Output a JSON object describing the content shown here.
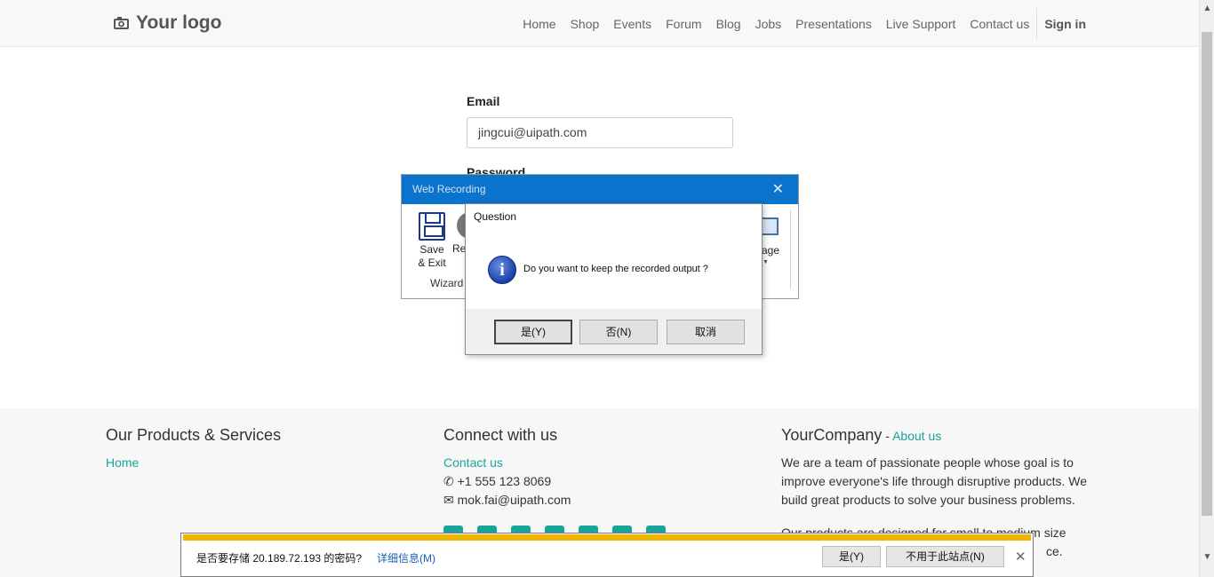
{
  "header": {
    "logo_text": "Your logo",
    "nav": [
      "Home",
      "Shop",
      "Events",
      "Forum",
      "Blog",
      "Jobs",
      "Presentations",
      "Live Support",
      "Contact us"
    ],
    "signin": "Sign in"
  },
  "form": {
    "email_label": "Email",
    "email_value": "jingcui@uipath.com",
    "password_label": "Password"
  },
  "recorder": {
    "title": "Web Recording",
    "save_label_1": "Save",
    "save_label_2": "& Exit",
    "re_label": "Re",
    "group_label": "Wizard",
    "image_label": "age"
  },
  "dialog": {
    "title": "Question",
    "message": "Do you want to keep the recorded output ?",
    "yes": "是(Y)",
    "no": "否(N)",
    "cancel": "取消"
  },
  "footer": {
    "col1_title": "Our Products & Services",
    "col1_link": "Home",
    "col2_title": "Connect with us",
    "col2_link": "Contact us",
    "phone": "+1 555 123 8069",
    "email": "mok.fai@uipath.com",
    "col3_title": "YourCompany",
    "col3_sep": " - ",
    "col3_link": "About us",
    "about_text": "We are a team of passionate people whose goal is to improve everyone's life through disruptive products. We build great products to solve your business problems.",
    "products_text": "Our products are designed for small to medium size",
    "products_tail": "ce."
  },
  "password_bar": {
    "question": "是否要存储 20.189.72.193 的密码?",
    "more_info": "详细信息(M)",
    "yes": "是(Y)",
    "never": "不用于此站点(N)"
  }
}
